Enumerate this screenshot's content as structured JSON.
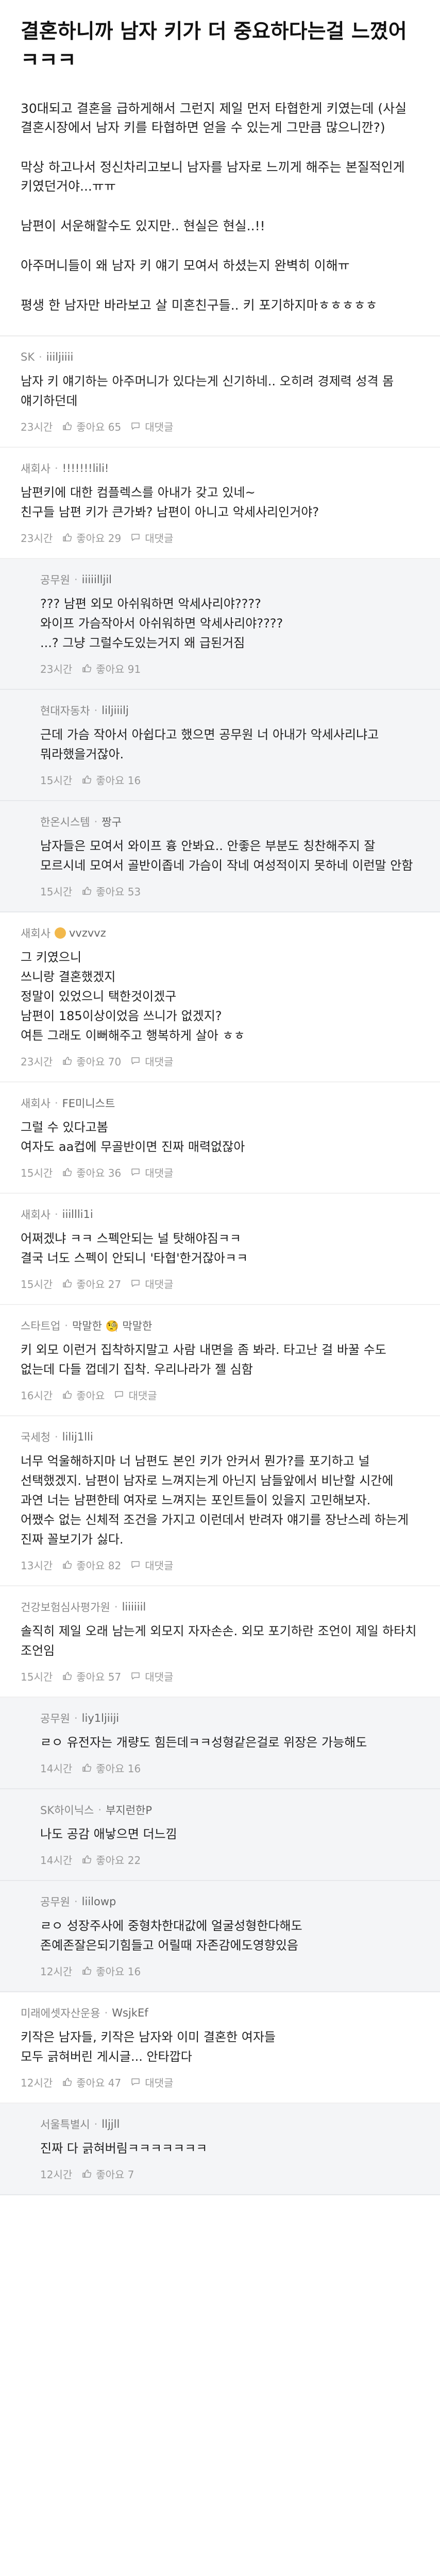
{
  "post": {
    "title": "결혼하니까 남자 키가 더 중요하다는걸 느꼈어ㅋㅋㅋ",
    "paragraphs": [
      "30대되고 결혼을 급하게해서 그런지 제일 먼저 타협한게 키였는데 (사실 결혼시장에서 남자 키를 타협하면 얻을 수 있는게 그만큼 많으니깐?)",
      "막상 하고나서 정신차리고보니 남자를 남자로 느끼게 해주는 본질적인게 키였던거야...ㅠㅠ",
      "남편이 서운해할수도 있지만.. 현실은 현실..!!",
      "아주머니들이 왜 남자 키 얘기 모여서 하셨는지 완벽히 이해ㅠ",
      "평생 한 남자만 바라보고 살 미혼친구들.. 키 포기하지마ㅎㅎㅎㅎㅎ"
    ]
  },
  "colors": {
    "accent_badge": "#f2b84b",
    "reply_background": "#f4f5f7",
    "meta_text": "#9a9a9a"
  },
  "comments": [
    {
      "company": "SK",
      "nick": "iiiljiiii",
      "text": "남자 키 얘기하는 아주머니가 있다는게 신기하네.. 오히려 경제력 성격 몸 얘기하던데",
      "time": "23시간",
      "likes": "좋아요 65",
      "reply_label": "대댓글",
      "reply": false
    },
    {
      "company": "새회사",
      "nick": "!!!!!!!lili!",
      "text": "남편키에 대한 컴플렉스를 아내가 갖고 있네~\n친구들 남편 키가 큰가봐? 남편이 아니고 악세사리인거야?",
      "time": "23시간",
      "likes": "좋아요 29",
      "reply_label": "대댓글",
      "reply": false
    },
    {
      "company": "공무원",
      "nick": "iiiiilljil",
      "text": "??? 남편 외모 아쉬워하면 악세사리야????\n와이프 가슴작아서 아쉬워하면 악세사리야????\n...? 그냥 그럴수도있는거지 왜 급된거짐",
      "time": "23시간",
      "likes": "좋아요 91",
      "reply_label": "",
      "reply": true
    },
    {
      "company": "현대자동차",
      "nick": "liljiiilj",
      "text": "근데 가슴 작아서 아쉽다고 했으면 공무원 너 아내가 악세사리냐고 뭐라했을거잖아.",
      "time": "15시간",
      "likes": "좋아요 16",
      "reply_label": "",
      "reply": true
    },
    {
      "company": "한온시스템",
      "nick": "짱구",
      "text": "남자들은 모여서 와이프 흉 안봐요.. 안좋은 부분도 칭찬해주지 잘 모르시네 모여서 골반이좁네 가슴이 작네 여성적이지 못하네 이런말 안함",
      "time": "15시간",
      "likes": "좋아요 53",
      "reply_label": "",
      "reply": true
    },
    {
      "company": "새회사",
      "nick": "vvzvvz",
      "badge": true,
      "text": "그 키였으니\n쓰니랑 결혼했겠지\n정말이 있었으니 택한것이겠구\n남편이 185이상이었음 쓰니가 없겠지?\n여튼 그래도 이뻐해주고 행복하게 살아 ㅎㅎ",
      "time": "23시간",
      "likes": "좋아요 70",
      "reply_label": "대댓글",
      "reply": false
    },
    {
      "company": "새회사",
      "nick": "FE미니스트",
      "text": "그럴 수 있다고봄\n여자도 aa컵에 무골반이면 진짜 매력없잖아",
      "time": "15시간",
      "likes": "좋아요 36",
      "reply_label": "대댓글",
      "reply": false
    },
    {
      "company": "새회사",
      "nick": "iiillli1i",
      "text": "어쩌겠냐 ㅋㅋ 스펙안되는 널 탓해야짐ㅋㅋ\n결국 너도 스펙이 안되니 '타협'한거잖아ㅋㅋ",
      "time": "15시간",
      "likes": "좋아요 27",
      "reply_label": "대댓글",
      "reply": false
    },
    {
      "company": "스타트업",
      "nick": "막말한 🧐 막말한",
      "text": "키 외모 이런거 집착하지말고 사람 내면을 좀 봐라. 타고난 걸 바꿀 수도 없는데 다들 껍데기 집착. 우리나라가 젤 심함",
      "time": "16시간",
      "likes": "좋아요",
      "reply_label": "대댓글",
      "reply": false
    },
    {
      "company": "국세청",
      "nick": "lilij1lli",
      "text": "너무 억울해하지마 너 남편도 본인 키가 안커서 뭔가?를 포기하고 널 선택했겠지. 남편이 남자로 느껴지는게 아닌지 남들앞에서 비난할 시간에 과연 너는 남편한테 여자로 느껴지는 포인트들이 있을지 고민해보자.\n어쨌수 없는 신체적 조건을 가지고 이런데서 반려자 얘기를 장난스레 하는게 진짜 꼴보기가 싫다.",
      "time": "13시간",
      "likes": "좋아요 82",
      "reply_label": "대댓글",
      "reply": false
    },
    {
      "company": "건강보험심사평가원",
      "nick": "liiiiiil",
      "text": "솔직히 제일 오래 남는게 외모지 자자손손. 외모 포기하란 조언이 제일 하타치 조언임",
      "time": "15시간",
      "likes": "좋아요 57",
      "reply_label": "대댓글",
      "reply": false
    },
    {
      "company": "공무원",
      "nick": "liy1ljiiji",
      "text": "ㄹㅇ 유전자는 개량도 힘든데ㅋㅋ성형같은걸로 위장은 가능해도",
      "time": "14시간",
      "likes": "좋아요 16",
      "reply_label": "",
      "reply": true
    },
    {
      "company": "SK하이닉스",
      "nick": "부지런한P",
      "text": "나도 공감 애낳으면 더느낌",
      "time": "14시간",
      "likes": "좋아요 22",
      "reply_label": "",
      "reply": true
    },
    {
      "company": "공무원",
      "nick": "liilowp",
      "text": "ㄹㅇ 성장주사에 중형차한대값에 얼굴성형한다해도 존예존잘은되기힘들고 어릴때 자존감에도영향있음",
      "time": "12시간",
      "likes": "좋아요 16",
      "reply_label": "",
      "reply": true
    },
    {
      "company": "미래에셋자산운용",
      "nick": "WsjkEf",
      "text": "키작은 남자들, 키작은 남자와 이미 결혼한 여자들\n모두 긁혀버린 게시글... 안타깝다",
      "time": "12시간",
      "likes": "좋아요 47",
      "reply_label": "대댓글",
      "reply": false
    },
    {
      "company": "서울특별시",
      "nick": "lljjll",
      "text": "진짜 다 긁혀버림ㅋㅋㅋㅋㅋㅋㅋ",
      "time": "12시간",
      "likes": "좋아요 7",
      "reply_label": "",
      "reply": true
    }
  ]
}
